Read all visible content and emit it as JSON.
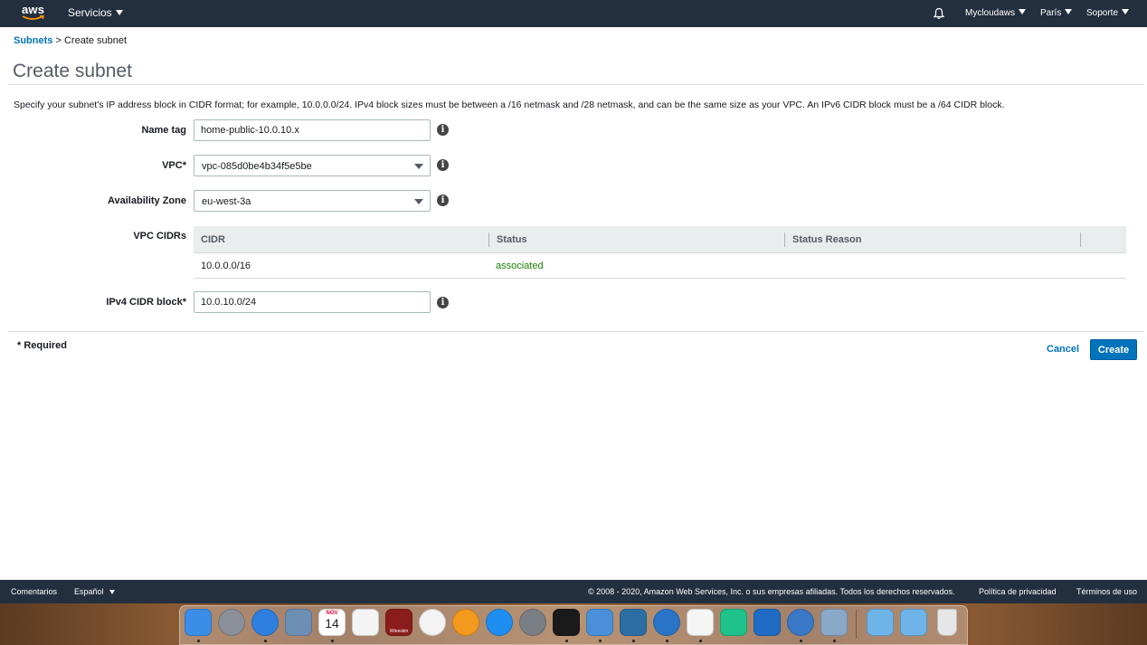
{
  "topnav": {
    "logo_text": "aws",
    "services_label": "Servicios",
    "account_label": "Mycloudaws",
    "region_label": "París",
    "support_label": "Soporte"
  },
  "breadcrumb": {
    "parent": "Subnets",
    "separator": ">",
    "current": "Create subnet"
  },
  "page": {
    "title": "Create subnet",
    "description": "Specify your subnet's IP address block in CIDR format; for example, 10.0.0.0/24. IPv4 block sizes must be between a /16 netmask and /28 netmask, and can be the same size as your VPC. An IPv6 CIDR block must be a /64 CIDR block."
  },
  "form": {
    "name_tag": {
      "label": "Name tag",
      "value": "home-public-10.0.10.x"
    },
    "vpc": {
      "label": "VPC*",
      "value": "vpc-085d0be4b34f5e5be"
    },
    "availability_zone": {
      "label": "Availability Zone",
      "value": "eu-west-3a"
    },
    "vpc_cidrs": {
      "label": "VPC CIDRs",
      "columns": [
        "CIDR",
        "Status",
        "Status Reason"
      ],
      "rows": [
        {
          "cidr": "10.0.0.0/16",
          "status": "associated",
          "status_reason": ""
        }
      ]
    },
    "ipv4_cidr": {
      "label": "IPv4 CIDR block*",
      "value": "10.0.10.0/24"
    },
    "info_glyph": "i"
  },
  "actions": {
    "required_note": "* Required",
    "cancel_label": "Cancel",
    "create_label": "Create"
  },
  "footer": {
    "comments": "Comentarios",
    "language": "Español",
    "copyright": "© 2008 - 2020, Amazon Web Services, Inc. o sus empresas afiliadas. Todos los derechos reservados.",
    "privacy": "Política de privacidad",
    "terms": "Términos de uso"
  },
  "dock": {
    "calendar_month": "NOV",
    "calendar_day": "14",
    "wineskin_label": "Wineskin",
    "apps": [
      {
        "name": "finder-icon",
        "color": "#3b8ee8",
        "running": true
      },
      {
        "name": "launchpad-icon",
        "color": "#8a8f98",
        "running": false
      },
      {
        "name": "safari-icon",
        "color": "#2f7fe0",
        "running": true
      },
      {
        "name": "preview-icon",
        "color": "#6d8fb5",
        "running": false
      },
      {
        "name": "calendar-icon",
        "color": "#ffffff",
        "running": true
      },
      {
        "name": "reminders-icon",
        "color": "#f4f4f4",
        "running": false
      },
      {
        "name": "wineskin-icon",
        "color": "#8a1c1c",
        "running": false
      },
      {
        "name": "itunes-icon",
        "color": "#f3f3f3",
        "running": false
      },
      {
        "name": "ibooks-icon",
        "color": "#f39a1e",
        "running": false
      },
      {
        "name": "app-store-icon",
        "color": "#1f8ef1",
        "running": false
      },
      {
        "name": "system-preferences-icon",
        "color": "#7a7f86",
        "running": false
      },
      {
        "name": "terminal-icon",
        "color": "#1a1a1a",
        "running": true
      },
      {
        "name": "vmware-icon",
        "color": "#4a90d9",
        "running": true
      },
      {
        "name": "brackets-icon",
        "color": "#2c6ea3",
        "running": true
      },
      {
        "name": "quicktime-icon",
        "color": "#2a74c7",
        "running": true
      },
      {
        "name": "textedit-icon",
        "color": "#f5f5f5",
        "running": true
      },
      {
        "name": "sourcetree-icon",
        "color": "#1ec28b",
        "running": false
      },
      {
        "name": "wireshark-icon",
        "color": "#1f6cc4",
        "running": false
      },
      {
        "name": "network-radar-icon",
        "color": "#3a78c8",
        "running": true
      },
      {
        "name": "photo-viewer-icon",
        "color": "#8aa8c8",
        "running": true
      },
      {
        "name": "applications-folder-icon",
        "color": "#6fb4e8",
        "running": false
      },
      {
        "name": "downloads-folder-icon",
        "color": "#6fb4e8",
        "running": false
      },
      {
        "name": "trash-icon",
        "color": "#e6e6e6",
        "running": false
      }
    ]
  }
}
